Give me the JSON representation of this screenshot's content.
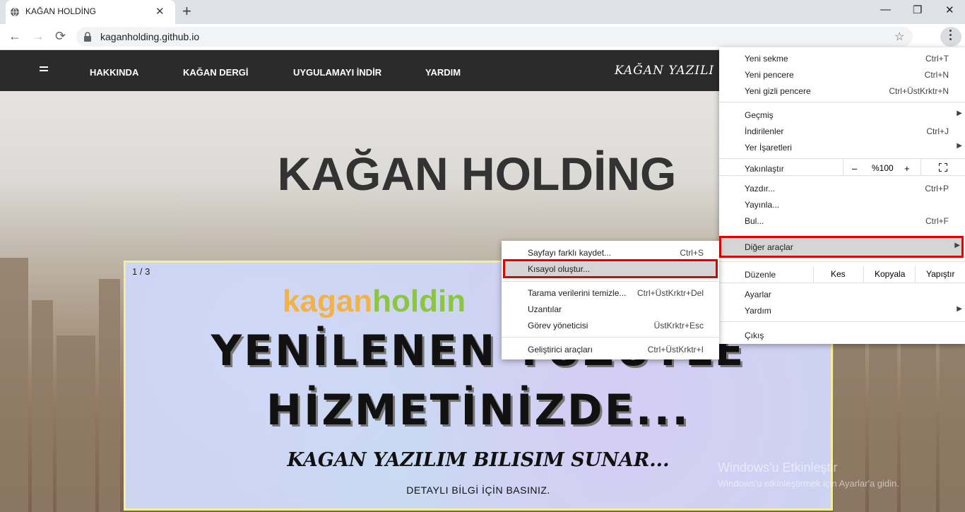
{
  "browser": {
    "tab_title": "KAĞAN HOLDİNG",
    "tab_close": "✕",
    "new_tab": "+",
    "window_controls": {
      "minimize": "—",
      "maximize": "❐",
      "close": "✕"
    },
    "nav": {
      "back": "←",
      "forward": "→",
      "reload": "⟳"
    },
    "url": "kaganholding.github.io",
    "bookmark_icon": "☆"
  },
  "site": {
    "nav_links": [
      "HAKKINDA",
      "KAĞAN DERGİ",
      "UYGULAMAYI İNDİR",
      "YARDIM"
    ],
    "brand": "KAĞAN YAZILI",
    "hero_title": "KAĞAN HOLDİNG",
    "slide": {
      "counter": "1 / 3",
      "logo_a": "kagan",
      "logo_b": "holdin",
      "line1": "YENİLENEN YÜZÜYLE",
      "line2": "HİZMETİNİZDE...",
      "subtitle": "KAGAN YAZILIM BILISIM SUNAR...",
      "cta": "DETAYLI BİLGİ İÇİN BASINIZ."
    },
    "watermark_title": "Windows'u Etkinleştir",
    "watermark_sub": "Windows'u etkinleştirmek için Ayarlar'a gidin."
  },
  "chrome_menu": {
    "new_tab": {
      "label": "Yeni sekme",
      "shortcut": "Ctrl+T"
    },
    "new_window": {
      "label": "Yeni pencere",
      "shortcut": "Ctrl+N"
    },
    "incognito": {
      "label": "Yeni gizli pencere",
      "shortcut": "Ctrl+ÜstKrktr+N"
    },
    "history": {
      "label": "Geçmiş"
    },
    "downloads": {
      "label": "İndirilenler",
      "shortcut": "Ctrl+J"
    },
    "bookmarks": {
      "label": "Yer İşaretleri"
    },
    "zoom": {
      "label": "Yakınlaştır",
      "minus": "–",
      "value": "%100",
      "plus": "+"
    },
    "print": {
      "label": "Yazdır...",
      "shortcut": "Ctrl+P"
    },
    "cast": {
      "label": "Yayınla..."
    },
    "find": {
      "label": "Bul...",
      "shortcut": "Ctrl+F"
    },
    "more_tools": {
      "label": "Diğer araçlar"
    },
    "edit": {
      "label": "Düzenle",
      "cut": "Kes",
      "copy": "Kopyala",
      "paste": "Yapıştır"
    },
    "settings": {
      "label": "Ayarlar"
    },
    "help": {
      "label": "Yardım"
    },
    "exit": {
      "label": "Çıkış"
    },
    "arrow": "▶"
  },
  "more_tools_menu": {
    "save_page": {
      "label": "Sayfayı farklı kaydet...",
      "shortcut": "Ctrl+S"
    },
    "create_shortcut": {
      "label": "Kısayol oluştur..."
    },
    "clear_data": {
      "label": "Tarama verilerini temizle...",
      "shortcut": "Ctrl+ÜstKrktr+Del"
    },
    "extensions": {
      "label": "Uzantılar"
    },
    "task_manager": {
      "label": "Görev yöneticisi",
      "shortcut": "ÜstKrktr+Esc"
    },
    "dev_tools": {
      "label": "Geliştirici araçları",
      "shortcut": "Ctrl+ÜstKrktr+I"
    }
  },
  "colors": {
    "highlight_border": "#e00000",
    "site_nav": "#2b2b2b",
    "logo_orange": "#f2b24a",
    "logo_green": "#8cc63f"
  }
}
